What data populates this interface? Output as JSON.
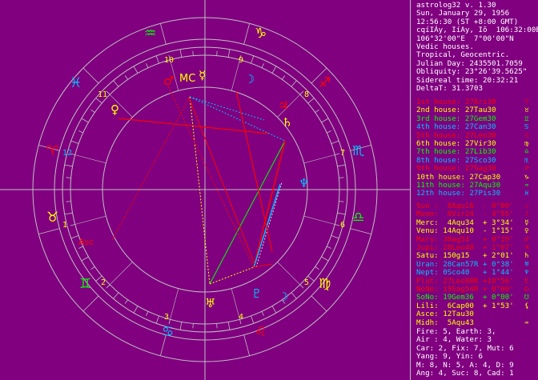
{
  "info": {
    "lines": [
      "astrolog32 v. 1.30",
      "Sun, January 29, 1956",
      "12:56:30 (ST +8:00 GMT)",
      "cqíIÁy, IíAy, Iõ  106:32:00E",
      "106°32'00\"E  7°00'00\"N",
      "Vedic houses.",
      "Tropical, Geocentric.",
      "Julian Day: 2435501.7059",
      "Obliquity: 23°26'39.5625\"",
      "Sidereal time: 20:32:21",
      "DeltaT: 31.3703"
    ]
  },
  "houses": [
    {
      "label": "1st house: 27Ari30",
      "glyph": "♈",
      "color": "#ff0000"
    },
    {
      "label": "2nd house: 27Tau30",
      "glyph": "♉",
      "color": "#ffff00"
    },
    {
      "label": "3rd house: 27Gem30",
      "glyph": "♊",
      "color": "#00ff00"
    },
    {
      "label": "4th house: 27Can30",
      "glyph": "♋",
      "color": "#00c0ff"
    },
    {
      "label": "5th house: 27Leo30",
      "glyph": "♌",
      "color": "#ff0000"
    },
    {
      "label": "6th house: 27Vir30",
      "glyph": "♍",
      "color": "#ffff00"
    },
    {
      "label": "7th house: 27Lib30",
      "glyph": "♎",
      "color": "#00ff00"
    },
    {
      "label": "8th house: 27Sco30",
      "glyph": "♏",
      "color": "#00c0ff"
    },
    {
      "label": "9th house: 27Sag30",
      "glyph": "♐",
      "color": "#ff0000"
    },
    {
      "label": "10th house: 27Cap30",
      "glyph": "♑",
      "color": "#ffff00"
    },
    {
      "label": "11th house: 27Aqu30",
      "glyph": "♒",
      "color": "#00ff00"
    },
    {
      "label": "12th house: 27Pis30",
      "glyph": "♓",
      "color": "#00c0ff"
    }
  ],
  "planets": [
    {
      "label": "Sun :  8Aqu16  - 0°00'",
      "glyph": "☉",
      "color": "#ff0000"
    },
    {
      "label": "Moon:  0Vir24  - 4°55'",
      "glyph": "☽",
      "color": "#ff0000"
    },
    {
      "label": "Merc:  4Aqu34  + 3°34'",
      "glyph": "☿",
      "color": "#ffff00"
    },
    {
      "label": "Venu: 14Aqu10  - 1°15'",
      "glyph": "♀",
      "color": "#ffff00"
    },
    {
      "label": "Mars: 30ag54   + 0°19'",
      "glyph": "♂",
      "color": "#ff0000"
    },
    {
      "label": "Jupi: 28Leo48  + 1°07'",
      "glyph": "♃",
      "color": "#ff0000"
    },
    {
      "label": "Satu: 150g15   + 2°01'",
      "glyph": "♄",
      "color": "#ffff00"
    },
    {
      "label": "Uran: 28Can57R + 0°38'",
      "glyph": "♅",
      "color": "#00c0ff"
    },
    {
      "label": "Nept: 0Sco40   + 1°44'",
      "glyph": "♆",
      "color": "#00c0ff"
    },
    {
      "label": "Plut: 27Leo08R +10°56'",
      "glyph": "♇",
      "color": "#ff0000"
    },
    {
      "label": "NoNo: 19Sag54R + 0°00'",
      "glyph": "☊",
      "color": "#ff0000"
    },
    {
      "label": "SoNo: 19Gem36  + 0°00'",
      "glyph": "☋",
      "color": "#00ff00"
    },
    {
      "label": "Lili:  6Cap00  + 1°53'",
      "glyph": "⚸",
      "color": "#ffff00"
    },
    {
      "label": "Asce: 12Tau30",
      "glyph": "",
      "color": "#ffff00"
    },
    {
      "label": "Midh:  5Aqu43",
      "glyph": "♒",
      "color": "#ffff00"
    }
  ],
  "stats": [
    "Fire: 5, Earth: 3,",
    "Air : 4, Water: 3",
    "Car: 2, Fix: 7, Mut: 6",
    "Yang: 9, Yin: 6",
    "M: 8, N: 5, A: 4, D: 9",
    "Ang: 4, Suc: 8, Cad: 1"
  ],
  "chart": {
    "house_numbers": [
      "1",
      "2",
      "3",
      "4",
      "5",
      "6",
      "7",
      "8",
      "9",
      "10",
      "11",
      "12"
    ],
    "sign_glyphs": [
      "♈",
      "♉",
      "♊",
      "♋",
      "♌",
      "♍",
      "♎",
      "♏",
      "♐",
      "♑",
      "♒",
      "♓"
    ],
    "planet_marks": [
      "♀",
      "☿",
      "♃",
      "♄",
      "♆",
      "♇",
      "♅",
      "☽",
      "MC",
      "Asc",
      "♂",
      "☽"
    ],
    "colors": {
      "background": "#800080",
      "red": "#ff0000",
      "yellow": "#ffff00",
      "green": "#00ff00",
      "cyan": "#00c0ff",
      "white": "#ffffff",
      "grey": "#c0c0c0"
    }
  }
}
